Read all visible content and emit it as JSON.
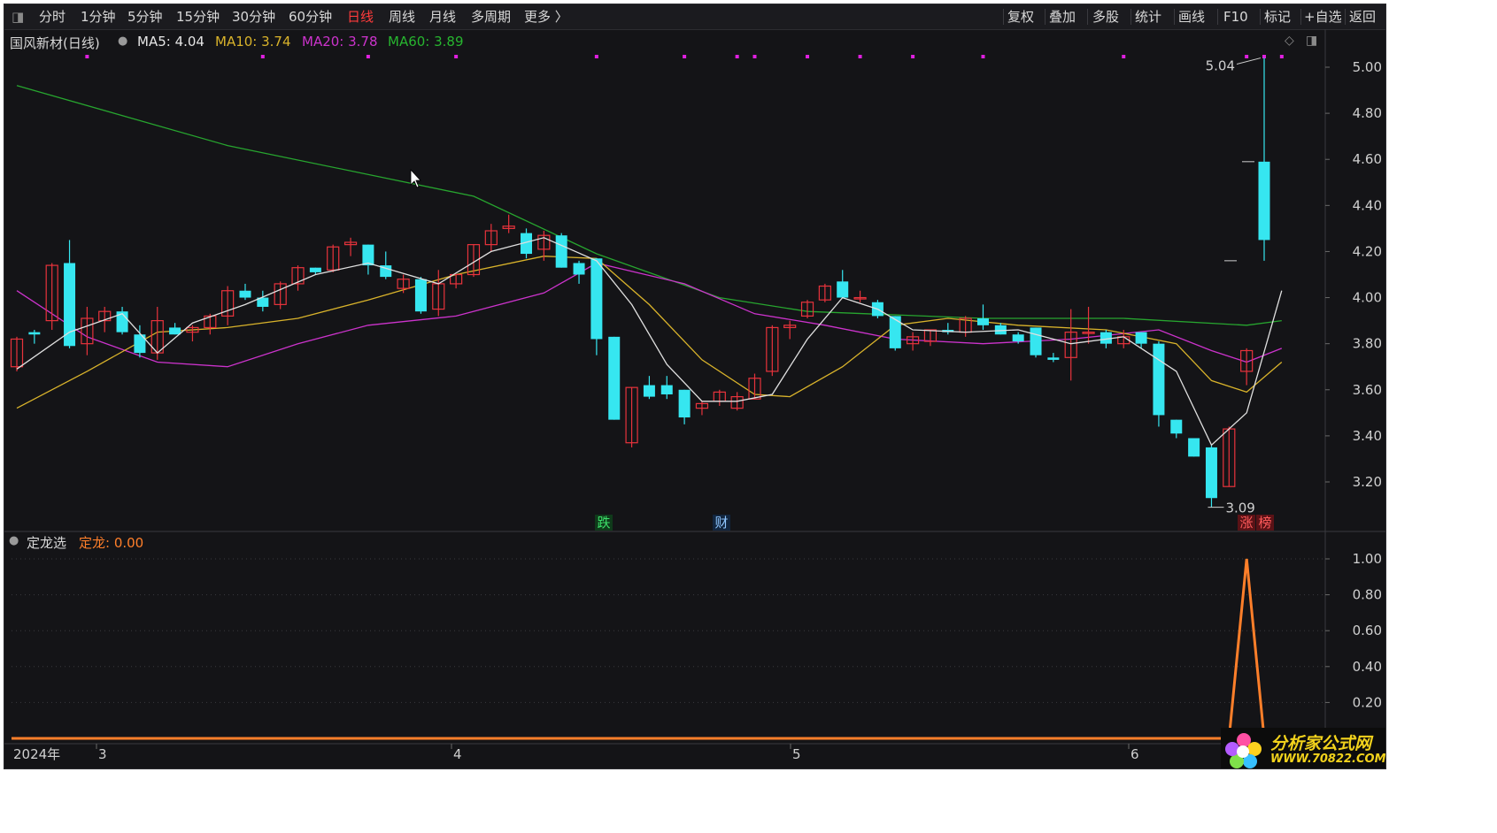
{
  "toolbar": {
    "left_items": [
      "分时",
      "1分钟",
      "5分钟",
      "15分钟",
      "30分钟",
      "60分钟",
      "日线",
      "周线",
      "月线",
      "多周期",
      "更多 〉"
    ],
    "active_item": "日线",
    "right_items": [
      "复权",
      "叠加",
      "多股",
      "统计",
      "画线",
      "F10",
      "标记",
      "+自选",
      "返回"
    ]
  },
  "main_legend": {
    "stock": "国风新材(日线)",
    "ma5": "MA5: 4.04",
    "ma10": "MA10: 3.74",
    "ma20": "MA20: 3.78",
    "ma60": "MA60: 3.89"
  },
  "sub_legend": {
    "indicator": "定龙选",
    "value": "定龙: 0.00"
  },
  "colors": {
    "up": "#e8333c",
    "down": "#36e6f0",
    "ma5": "#e0e0e0",
    "ma10": "#d9b32b",
    "ma20": "#cc33cc",
    "ma60": "#27a52f",
    "indicator": "#ff7f2a",
    "marker_dot": "#e020e0",
    "accent_active": "#ff3b3b"
  },
  "price_axis": [
    "5.00",
    "4.80",
    "4.60",
    "4.40",
    "4.20",
    "4.00",
    "3.80",
    "3.60",
    "3.40",
    "3.20"
  ],
  "indicator_axis": [
    "1.00",
    "0.80",
    "0.60",
    "0.40",
    "0.20"
  ],
  "time_axis": [
    "2024年",
    "3",
    "4",
    "5",
    "6"
  ],
  "annotations": {
    "high_label": "5.04",
    "low_label": "3.09",
    "badge_die": "跌",
    "badge_cai": "财",
    "badge_zhang": "涨",
    "badge_bang": "榜"
  },
  "watermark": {
    "title": "分析家公式网",
    "url": "WWW.70822.COM"
  },
  "chart_data": {
    "type": "candlestick",
    "x_labels": [
      "3",
      "4",
      "5",
      "6"
    ],
    "ylim": [
      3.05,
      5.06
    ],
    "candles": [
      [
        3.7,
        3.83,
        3.68,
        3.82
      ],
      [
        3.85,
        3.86,
        3.8,
        3.84
      ],
      [
        3.9,
        4.15,
        3.86,
        4.14
      ],
      [
        4.15,
        4.25,
        3.78,
        3.79
      ],
      [
        3.8,
        3.96,
        3.75,
        3.91
      ],
      [
        3.9,
        3.96,
        3.85,
        3.94
      ],
      [
        3.94,
        3.96,
        3.84,
        3.85
      ],
      [
        3.84,
        3.88,
        3.74,
        3.76
      ],
      [
        3.76,
        3.96,
        3.73,
        3.9
      ],
      [
        3.87,
        3.89,
        3.84,
        3.84
      ],
      [
        3.85,
        3.88,
        3.81,
        3.87
      ],
      [
        3.87,
        3.93,
        3.84,
        3.92
      ],
      [
        3.92,
        4.05,
        3.88,
        4.03
      ],
      [
        4.03,
        4.06,
        3.99,
        4.0
      ],
      [
        4.0,
        4.03,
        3.94,
        3.96
      ],
      [
        3.97,
        4.07,
        3.95,
        4.06
      ],
      [
        4.06,
        4.14,
        4.03,
        4.13
      ],
      [
        4.13,
        4.13,
        4.1,
        4.11
      ],
      [
        4.12,
        4.23,
        4.11,
        4.22
      ],
      [
        4.23,
        4.26,
        4.18,
        4.24
      ],
      [
        4.23,
        4.23,
        4.1,
        4.14
      ],
      [
        4.14,
        4.2,
        4.08,
        4.09
      ],
      [
        4.04,
        4.1,
        4.02,
        4.08
      ],
      [
        4.08,
        4.09,
        3.93,
        3.94
      ],
      [
        3.95,
        4.12,
        3.92,
        4.06
      ],
      [
        4.06,
        4.1,
        4.04,
        4.1
      ],
      [
        4.1,
        4.23,
        4.09,
        4.23
      ],
      [
        4.23,
        4.32,
        4.2,
        4.29
      ],
      [
        4.3,
        4.36,
        4.28,
        4.31
      ],
      [
        4.28,
        4.3,
        4.17,
        4.19
      ],
      [
        4.21,
        4.29,
        4.16,
        4.27
      ],
      [
        4.27,
        4.28,
        4.13,
        4.13
      ],
      [
        4.15,
        4.16,
        4.06,
        4.1
      ],
      [
        4.17,
        4.17,
        3.75,
        3.82
      ],
      [
        3.83,
        3.83,
        3.47,
        3.47
      ],
      [
        3.37,
        3.61,
        3.35,
        3.61
      ],
      [
        3.62,
        3.66,
        3.56,
        3.57
      ],
      [
        3.62,
        3.66,
        3.56,
        3.58
      ],
      [
        3.6,
        3.6,
        3.45,
        3.48
      ],
      [
        3.52,
        3.55,
        3.49,
        3.54
      ],
      [
        3.55,
        3.6,
        3.53,
        3.59
      ],
      [
        3.52,
        3.59,
        3.51,
        3.57
      ],
      [
        3.56,
        3.67,
        3.56,
        3.65
      ],
      [
        3.68,
        3.88,
        3.66,
        3.87
      ],
      [
        3.87,
        3.9,
        3.82,
        3.88
      ],
      [
        3.92,
        3.99,
        3.91,
        3.98
      ],
      [
        3.99,
        4.06,
        3.98,
        4.05
      ],
      [
        4.07,
        4.12,
        4.0,
        4.0
      ],
      [
        4.0,
        4.03,
        3.98,
        4.0
      ],
      [
        3.98,
        3.99,
        3.91,
        3.92
      ],
      [
        3.92,
        3.92,
        3.77,
        3.78
      ],
      [
        3.8,
        3.85,
        3.77,
        3.83
      ],
      [
        3.81,
        3.86,
        3.79,
        3.86
      ],
      [
        3.86,
        3.89,
        3.84,
        3.85
      ],
      [
        3.85,
        3.92,
        3.83,
        3.91
      ],
      [
        3.91,
        3.97,
        3.86,
        3.88
      ],
      [
        3.88,
        3.89,
        3.84,
        3.84
      ],
      [
        3.84,
        3.85,
        3.8,
        3.81
      ],
      [
        3.87,
        3.87,
        3.74,
        3.75
      ],
      [
        3.74,
        3.76,
        3.72,
        3.73
      ],
      [
        3.74,
        3.95,
        3.64,
        3.85
      ],
      [
        3.85,
        3.96,
        3.8,
        3.85
      ],
      [
        3.85,
        3.86,
        3.78,
        3.8
      ],
      [
        3.8,
        3.86,
        3.78,
        3.83
      ],
      [
        3.85,
        3.85,
        3.78,
        3.8
      ],
      [
        3.8,
        3.81,
        3.44,
        3.49
      ],
      [
        3.47,
        3.47,
        3.39,
        3.41
      ],
      [
        3.39,
        3.39,
        3.31,
        3.31
      ],
      [
        3.35,
        3.36,
        3.09,
        3.13
      ],
      [
        3.18,
        3.44,
        3.18,
        3.43
      ],
      [
        3.68,
        3.78,
        3.62,
        3.77
      ],
      [
        4.59,
        5.04,
        4.16,
        4.25
      ]
    ],
    "ma60": [
      [
        0,
        4.92
      ],
      [
        12,
        4.66
      ],
      [
        26,
        4.44
      ],
      [
        33,
        4.19
      ],
      [
        40,
        4.0
      ],
      [
        45,
        3.94
      ],
      [
        55,
        3.91
      ],
      [
        63,
        3.91
      ],
      [
        70,
        3.88
      ],
      [
        72,
        3.9
      ]
    ],
    "ma20": [
      [
        0,
        4.03
      ],
      [
        4,
        3.83
      ],
      [
        8,
        3.72
      ],
      [
        12,
        3.7
      ],
      [
        16,
        3.8
      ],
      [
        20,
        3.88
      ],
      [
        25,
        3.92
      ],
      [
        30,
        4.02
      ],
      [
        33,
        4.15
      ],
      [
        38,
        4.06
      ],
      [
        42,
        3.93
      ],
      [
        46,
        3.88
      ],
      [
        50,
        3.82
      ],
      [
        55,
        3.8
      ],
      [
        60,
        3.82
      ],
      [
        65,
        3.86
      ],
      [
        68,
        3.77
      ],
      [
        70,
        3.72
      ],
      [
        72,
        3.78
      ]
    ],
    "ma10": [
      [
        0,
        3.52
      ],
      [
        4,
        3.68
      ],
      [
        8,
        3.85
      ],
      [
        12,
        3.87
      ],
      [
        16,
        3.91
      ],
      [
        20,
        3.99
      ],
      [
        25,
        4.1
      ],
      [
        30,
        4.18
      ],
      [
        33,
        4.17
      ],
      [
        36,
        3.97
      ],
      [
        39,
        3.73
      ],
      [
        42,
        3.58
      ],
      [
        44,
        3.57
      ],
      [
        47,
        3.7
      ],
      [
        50,
        3.88
      ],
      [
        53,
        3.91
      ],
      [
        57,
        3.88
      ],
      [
        62,
        3.86
      ],
      [
        66,
        3.8
      ],
      [
        68,
        3.64
      ],
      [
        70,
        3.59
      ],
      [
        72,
        3.72
      ]
    ],
    "ma5": [
      [
        0,
        3.69
      ],
      [
        3,
        3.85
      ],
      [
        6,
        3.93
      ],
      [
        8,
        3.76
      ],
      [
        10,
        3.89
      ],
      [
        13,
        3.97
      ],
      [
        17,
        4.1
      ],
      [
        20,
        4.15
      ],
      [
        24,
        4.06
      ],
      [
        27,
        4.2
      ],
      [
        30,
        4.26
      ],
      [
        33,
        4.16
      ],
      [
        35,
        3.97
      ],
      [
        37,
        3.71
      ],
      [
        39,
        3.55
      ],
      [
        41,
        3.55
      ],
      [
        43,
        3.58
      ],
      [
        45,
        3.82
      ],
      [
        47,
        4.0
      ],
      [
        49,
        3.95
      ],
      [
        51,
        3.86
      ],
      [
        54,
        3.85
      ],
      [
        57,
        3.86
      ],
      [
        60,
        3.8
      ],
      [
        63,
        3.83
      ],
      [
        66,
        3.68
      ],
      [
        68,
        3.36
      ],
      [
        70,
        3.5
      ],
      [
        72,
        4.03
      ]
    ],
    "indicator": [
      [
        0,
        0
      ],
      [
        69,
        0
      ],
      [
        70,
        1.0
      ],
      [
        71,
        0
      ],
      [
        72,
        0
      ]
    ],
    "indicator_ylim": [
      0,
      1.06
    ],
    "markers_top": [
      4,
      14,
      20,
      25,
      33,
      38,
      41,
      42,
      45,
      48,
      51,
      55,
      63,
      70,
      71,
      72
    ]
  }
}
